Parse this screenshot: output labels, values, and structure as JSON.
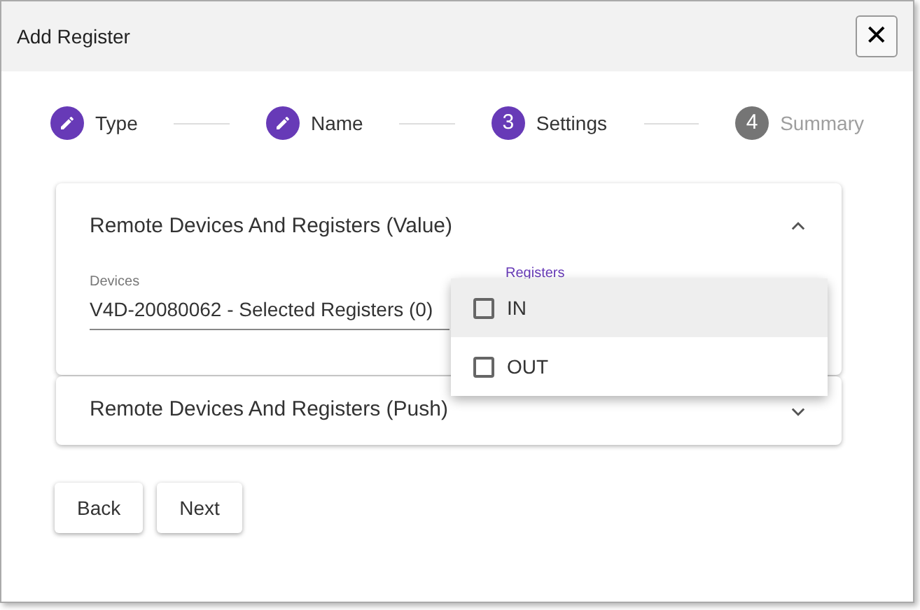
{
  "window": {
    "title": "Add Register",
    "close": "✕"
  },
  "steps": [
    {
      "label": "Type",
      "completed": true,
      "active": false
    },
    {
      "label": "Name",
      "completed": true,
      "active": false
    },
    {
      "label": "Settings",
      "number": "3",
      "completed": false,
      "active": true
    },
    {
      "label": "Summary",
      "number": "4",
      "completed": false,
      "active": false
    }
  ],
  "panels": [
    {
      "title": "Remote Devices And Registers (Value)",
      "expanded": true,
      "devices": {
        "label": "Devices",
        "value": "V4D-20080062 - Selected Registers (0)"
      },
      "registers": {
        "label": "Registers"
      }
    },
    {
      "title": "Remote Devices And Registers (Push)",
      "expanded": false
    }
  ],
  "menu": [
    {
      "label": "IN",
      "checked": false,
      "highlighted": true
    },
    {
      "label": "OUT",
      "checked": false,
      "highlighted": false
    }
  ],
  "buttons": [
    "Back",
    "Next"
  ]
}
